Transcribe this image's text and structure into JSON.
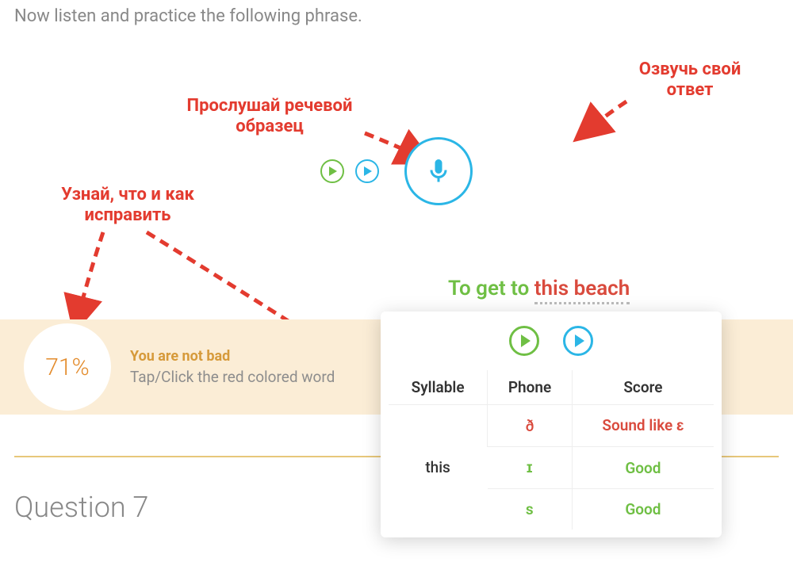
{
  "instruction": "Now listen and practice the following phrase.",
  "annotations": {
    "listen": "Прослушай речевой образец",
    "record": "Озвучь свой ответ",
    "fix": "Узнай, что и как исправить"
  },
  "phrase": {
    "part1": "To get to ",
    "part2": "this beach"
  },
  "feedback": {
    "score": "71%",
    "title": "You are not bad",
    "subtitle": "Tap/Click the red colored word"
  },
  "popup": {
    "headers": {
      "syllable": "Syllable",
      "phone": "Phone",
      "score": "Score"
    },
    "syllable": "this",
    "rows": [
      {
        "phone": "ð",
        "phone_class": "phone-red",
        "score": "Sound like ɛ",
        "score_class": "score-red"
      },
      {
        "phone": "ɪ",
        "phone_class": "phone-green",
        "score": "Good",
        "score_class": "score-green"
      },
      {
        "phone": "s",
        "phone_class": "phone-green",
        "score": "Good",
        "score_class": "score-green"
      }
    ]
  },
  "question_label": "Question 7"
}
